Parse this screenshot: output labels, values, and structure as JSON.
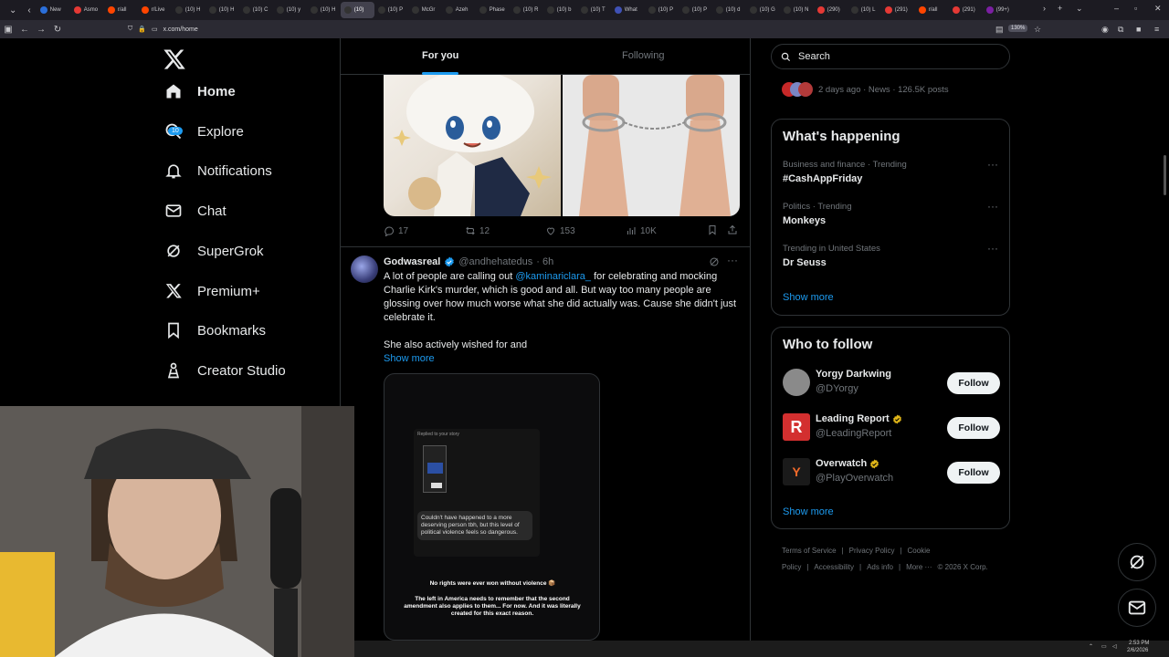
{
  "browser": {
    "tabs": [
      {
        "label": "New",
        "color": "#2b6fda"
      },
      {
        "label": "Asmo",
        "color": "#e53935"
      },
      {
        "label": "r/all",
        "color": "#ff4500"
      },
      {
        "label": "r/Live",
        "color": "#ff4500"
      },
      {
        "label": "(10) H",
        "color": "#333"
      },
      {
        "label": "(10) H",
        "color": "#333"
      },
      {
        "label": "(10) C",
        "color": "#333"
      },
      {
        "label": "(10) y",
        "color": "#333"
      },
      {
        "label": "(10) H",
        "color": "#333"
      },
      {
        "label": "(10)",
        "color": "#333"
      },
      {
        "label": "(10) P",
        "color": "#333"
      },
      {
        "label": "McGr",
        "color": "#333"
      },
      {
        "label": "Azeh",
        "color": "#333"
      },
      {
        "label": "Phase",
        "color": "#333"
      },
      {
        "label": "(10) R",
        "color": "#333"
      },
      {
        "label": "(10) b",
        "color": "#333"
      },
      {
        "label": "(10) T",
        "color": "#333"
      },
      {
        "label": "What",
        "color": "#3f51b5"
      },
      {
        "label": "(10) P",
        "color": "#333"
      },
      {
        "label": "(10) P",
        "color": "#333"
      },
      {
        "label": "(10) d",
        "color": "#333"
      },
      {
        "label": "(10) G",
        "color": "#333"
      },
      {
        "label": "(10) N",
        "color": "#333"
      },
      {
        "label": "(290)",
        "color": "#e53935"
      },
      {
        "label": "(10) L",
        "color": "#333"
      },
      {
        "label": "(291)",
        "color": "#e53935"
      },
      {
        "label": "r/all",
        "color": "#ff4500"
      },
      {
        "label": "(291)",
        "color": "#e53935"
      },
      {
        "label": "(99+)",
        "color": "#7b1fa2"
      }
    ],
    "active_tab_index": 9,
    "url": "x.com/home",
    "zoom": "130%"
  },
  "sidebar": {
    "items": [
      {
        "label": "Home",
        "icon": "home-icon",
        "active": true
      },
      {
        "label": "Explore",
        "icon": "search-icon",
        "active": false
      },
      {
        "label": "Notifications",
        "icon": "bell-icon",
        "active": false,
        "badge": "10"
      },
      {
        "label": "Chat",
        "icon": "mail-icon",
        "active": false
      },
      {
        "label": "SuperGrok",
        "icon": "grok-icon",
        "active": false
      },
      {
        "label": "Premium+",
        "icon": "x-icon",
        "active": false
      },
      {
        "label": "Bookmarks",
        "icon": "bookmark-icon",
        "active": false
      },
      {
        "label": "Creator Studio",
        "icon": "creator-icon",
        "active": false
      }
    ]
  },
  "feed": {
    "tab_for_you": "For you",
    "tab_following": "Following",
    "prev_post": {
      "replies": "17",
      "reposts": "12",
      "likes": "153",
      "views": "10K"
    },
    "post": {
      "name": "Godwasreal",
      "handle": "@andhehatedus",
      "time": "· 6h",
      "text_before_mention": "A lot of people are calling out ",
      "mention": "@kaminariclara_",
      "text_after_mention": " for celebrating and mocking Charlie Kirk's murder, which is good and all. But way too many people are glossing over how much worse what she did  actually was. Cause she didn't just celebrate it.",
      "text2": "She also actively wished for and",
      "show_more": "Show more",
      "story_label": "Replied to your story",
      "story_reply": "Couldn't have happened to a more deserving person tbh, but this level of political violence feels so dangerous.",
      "story_line1": "No rights were ever won without violence 📦",
      "story_line2": "The left in America needs to remember that the second amendment also applies to them... For now. And it was literally created for this exact reason."
    }
  },
  "right": {
    "search_placeholder": "Search",
    "news_meta": "2 days ago · News · 126.5K posts",
    "happening_title": "What's happening",
    "trends": [
      {
        "context": "Business and finance · Trending",
        "name": "#CashAppFriday"
      },
      {
        "context": "Politics · Trending",
        "name": "Monkeys"
      },
      {
        "context": "Trending in United States",
        "name": "Dr Seuss"
      }
    ],
    "show_more": "Show more",
    "wtf_title": "Who to follow",
    "follow": [
      {
        "name": "Yorgy Darkwing",
        "handle": "@DYorgy",
        "verified": false,
        "color": "#8a8a8a"
      },
      {
        "name": "Leading Report",
        "handle": "@LeadingReport",
        "verified": true,
        "color": "#d32f2f"
      },
      {
        "name": "Overwatch",
        "handle": "@PlayOverwatch",
        "verified": true,
        "color": "#1a1a1a"
      }
    ],
    "follow_label": "Follow",
    "footer": [
      "Terms of Service",
      "|",
      "Privacy Policy",
      "|",
      "Cookie Policy",
      "|",
      "Accessibility",
      "|",
      "Ads info",
      "|",
      "More ···",
      "© 2026 X Corp."
    ]
  },
  "taskbar": {
    "time": "2:53 PM",
    "date": "2/6/2026"
  },
  "colors": {
    "accent": "#1d9bf0",
    "verified": "#1d9bf0",
    "gold_verified": "#e2b719",
    "border": "#2f3336",
    "muted": "#71767b"
  }
}
